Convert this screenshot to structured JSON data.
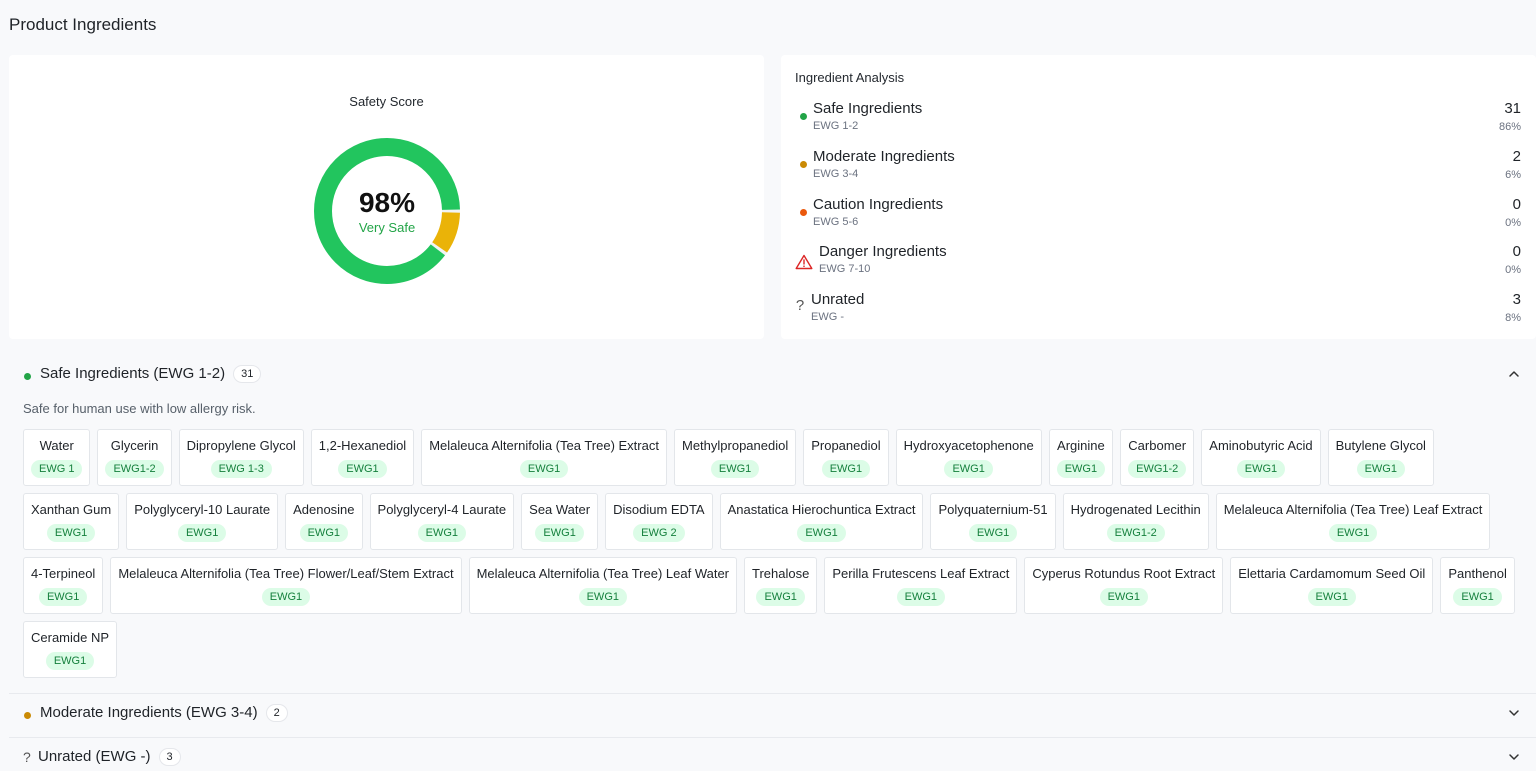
{
  "page_title": "Product Ingredients",
  "score": {
    "label": "Safety Score",
    "percent_text": "98%",
    "description": "Very Safe",
    "safe_fraction": 0.9,
    "moderate_fraction": 0.1,
    "colors": {
      "safe": "#22c55e",
      "moderate": "#eab308"
    }
  },
  "analysis": {
    "title": "Ingredient Analysis",
    "rows": [
      {
        "name": "Safe Ingredients",
        "range": "EWG 1-2",
        "count": "31",
        "pct": "86%",
        "color": "#22a447",
        "icon": "green-dot-icon"
      },
      {
        "name": "Moderate Ingredients",
        "range": "EWG 3-4",
        "count": "2",
        "pct": "6%",
        "color": "#ca8a04",
        "icon": "yellow-dot-icon"
      },
      {
        "name": "Caution Ingredients",
        "range": "EWG 5-6",
        "count": "0",
        "pct": "0%",
        "color": "#ea580c",
        "icon": "orange-dot-icon"
      },
      {
        "name": "Danger Ingredients",
        "range": "EWG 7-10",
        "count": "0",
        "pct": "0%",
        "color": "#dc2626",
        "icon": "warning-triangle-icon"
      },
      {
        "name": "Unrated",
        "range": "EWG -",
        "count": "3",
        "pct": "8%",
        "icon": "question-mark-icon",
        "glyph": "?"
      }
    ]
  },
  "sections": {
    "safe": {
      "title": "Safe Ingredients (EWG 1-2)",
      "count": "31",
      "description": "Safe for human use with low allergy risk.",
      "color": "#22a447",
      "chips": [
        {
          "name": "Water",
          "ewg": "EWG 1"
        },
        {
          "name": "Glycerin",
          "ewg": "EWG1-2"
        },
        {
          "name": "Dipropylene Glycol",
          "ewg": "EWG 1-3"
        },
        {
          "name": "1,2-Hexanediol",
          "ewg": "EWG1"
        },
        {
          "name": "Melaleuca Alternifolia (Tea Tree) Extract",
          "ewg": "EWG1"
        },
        {
          "name": "Methylpropanediol",
          "ewg": "EWG1"
        },
        {
          "name": "Propanediol",
          "ewg": "EWG1"
        },
        {
          "name": "Hydroxyacetophenone",
          "ewg": "EWG1"
        },
        {
          "name": "Arginine",
          "ewg": "EWG1"
        },
        {
          "name": "Carbomer",
          "ewg": "EWG1-2"
        },
        {
          "name": "Aminobutyric Acid",
          "ewg": "EWG1"
        },
        {
          "name": "Butylene Glycol",
          "ewg": "EWG1"
        },
        {
          "name": "Xanthan Gum",
          "ewg": "EWG1"
        },
        {
          "name": "Polyglyceryl-10 Laurate",
          "ewg": "EWG1"
        },
        {
          "name": "Adenosine",
          "ewg": "EWG1"
        },
        {
          "name": "Polyglyceryl-4 Laurate",
          "ewg": "EWG1"
        },
        {
          "name": "Sea Water",
          "ewg": "EWG1"
        },
        {
          "name": "Disodium EDTA",
          "ewg": "EWG 2"
        },
        {
          "name": "Anastatica Hierochuntica Extract",
          "ewg": "EWG1"
        },
        {
          "name": "Polyquaternium-51",
          "ewg": "EWG1"
        },
        {
          "name": "Hydrogenated Lecithin",
          "ewg": "EWG1-2"
        },
        {
          "name": "Melaleuca Alternifolia (Tea Tree) Leaf Extract",
          "ewg": "EWG1"
        },
        {
          "name": "4-Terpineol",
          "ewg": "EWG1"
        },
        {
          "name": "Melaleuca Alternifolia (Tea Tree) Flower/Leaf/Stem Extract",
          "ewg": "EWG1"
        },
        {
          "name": "Melaleuca Alternifolia (Tea Tree) Leaf Water",
          "ewg": "EWG1"
        },
        {
          "name": "Trehalose",
          "ewg": "EWG1"
        },
        {
          "name": "Perilla Frutescens Leaf Extract",
          "ewg": "EWG1"
        },
        {
          "name": "Cyperus Rotundus Root Extract",
          "ewg": "EWG1"
        },
        {
          "name": "Elettaria Cardamomum Seed Oil",
          "ewg": "EWG1"
        },
        {
          "name": "Panthenol",
          "ewg": "EWG1"
        },
        {
          "name": "Ceramide NP",
          "ewg": "EWG1"
        }
      ]
    },
    "moderate": {
      "title": "Moderate Ingredients (EWG 3-4)",
      "count": "2",
      "color": "#ca8a04"
    },
    "unrated": {
      "title": "Unrated (EWG -)",
      "count": "3",
      "glyph": "?"
    }
  }
}
